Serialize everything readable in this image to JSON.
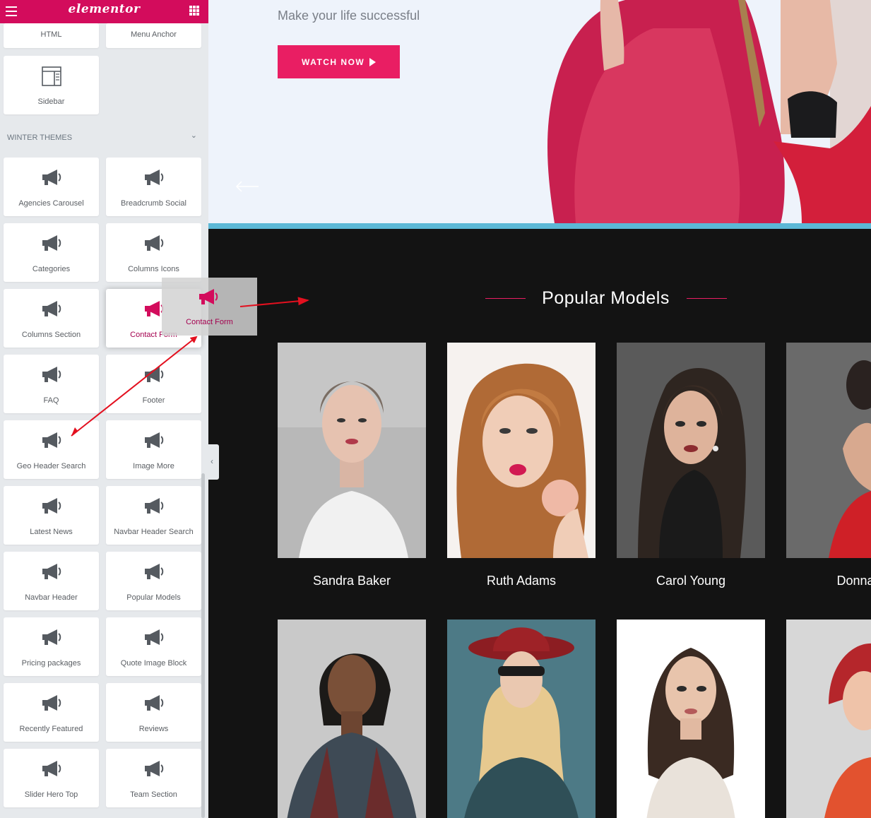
{
  "app": {
    "brand": "elementor",
    "menu_icon": "hamburger-menu-icon",
    "apps_icon": "grid-apps-icon"
  },
  "sidebar": {
    "top_widgets": [
      {
        "label": "HTML"
      },
      {
        "label": "Menu Anchor"
      }
    ],
    "sidebar_widget": {
      "label": "Sidebar",
      "icon": "sidebar-layout-icon"
    },
    "section": {
      "title": "WINTER THEMES",
      "chevron_icon": "chevron-down-icon"
    },
    "widgets": [
      {
        "label": "Agencies Carousel"
      },
      {
        "label": "Breadcrumb Social"
      },
      {
        "label": "Categories"
      },
      {
        "label": "Columns Icons"
      },
      {
        "label": "Columns Section"
      },
      {
        "label": "Contact Form"
      },
      {
        "label": "FAQ"
      },
      {
        "label": "Footer"
      },
      {
        "label": "Geo Header Search"
      },
      {
        "label": "Image More"
      },
      {
        "label": "Latest News"
      },
      {
        "label": "Navbar Header Search"
      },
      {
        "label": "Navbar Header"
      },
      {
        "label": "Popular Models"
      },
      {
        "label": "Pricing packages"
      },
      {
        "label": "Quote Image Block"
      },
      {
        "label": "Recently Featured"
      },
      {
        "label": "Reviews"
      },
      {
        "label": "Slider Hero Top"
      },
      {
        "label": "Team Section"
      }
    ],
    "widget_icon": "megaphone-icon"
  },
  "drag_ghost": {
    "label": "Contact Form",
    "icon": "megaphone-icon"
  },
  "hero": {
    "subtitle": "Make your life successful",
    "button_label": "WATCH NOW",
    "button_icon": "play-icon",
    "prev_icon": "arrow-left-icon"
  },
  "models": {
    "title": "Popular Models",
    "items": [
      {
        "name": "Sandra Baker"
      },
      {
        "name": "Ruth Adams"
      },
      {
        "name": "Carol Young"
      },
      {
        "name": "Donna"
      }
    ]
  },
  "colors": {
    "brand": "#d30c5c",
    "accent": "#e91e63",
    "panel": "#e6e9ec",
    "models_bg": "#131313",
    "hero_bg": "#eef3fb",
    "divider": "#5cb8d6"
  }
}
